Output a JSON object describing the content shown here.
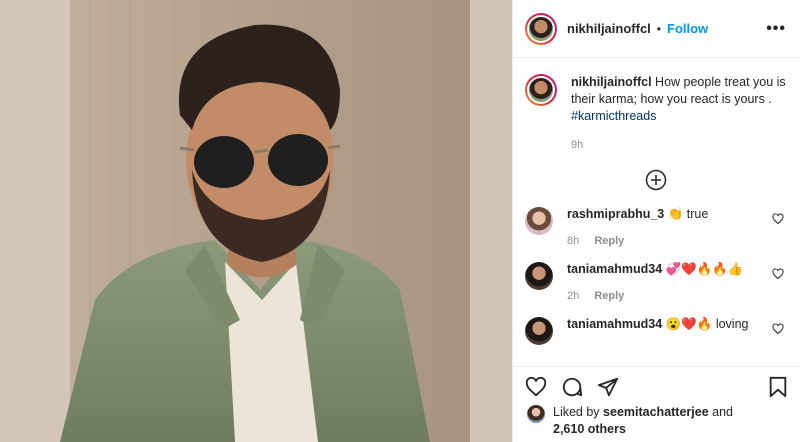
{
  "post": {
    "username": "nikhiljainoffcl",
    "follow_label": "Follow",
    "separator": "•",
    "more_label": "•••"
  },
  "caption": {
    "username": "nikhiljainoffcl",
    "text": "How people treat you is their karma; how you react is yours .",
    "hashtag": "#karmicthreads",
    "time": "9h"
  },
  "comments": [
    {
      "username": "rashmiprabhu_3",
      "text": "👏 true",
      "time": "8h",
      "reply_label": "Reply"
    },
    {
      "username": "taniamahmud34",
      "text": "💞❤️🔥🔥👍",
      "time": "2h",
      "reply_label": "Reply"
    },
    {
      "username": "taniamahmud34",
      "text": "😮❤️🔥 loving",
      "time": "",
      "reply_label": ""
    }
  ],
  "likes": {
    "prefix": "Liked by",
    "user": "seemitachatterjee",
    "conj": "and",
    "count": "2,610 others"
  },
  "colors": {
    "link": "#0095f6",
    "hashtag": "#00376b",
    "muted": "#8e8e8e"
  },
  "icons": [
    "more-options-icon",
    "load-more-comments-icon",
    "like-icon",
    "comment-icon",
    "share-icon",
    "save-icon"
  ]
}
